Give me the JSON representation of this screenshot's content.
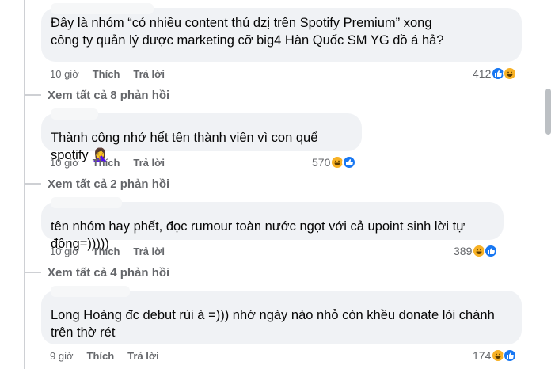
{
  "comments": [
    {
      "text": "Đây là nhóm “có nhiều content thú dzị trên Spotify Premium” xong công ty quản lý được marketing cỡ big4 Hàn Quốc SM YG đồ á hả?",
      "time": "10 giờ",
      "like_label": "Thích",
      "reply_label": "Trả lời",
      "reaction_count": "412",
      "reactions": [
        "like-icon",
        "haha-icon"
      ],
      "view_replies": "Xem tất cả 8 phản hồi"
    },
    {
      "text": "Thành công nhớ hết tên thành viên vì con quể spotify 🤦‍♀️",
      "time": "10 giờ",
      "like_label": "Thích",
      "reply_label": "Trả lời",
      "reaction_count": "570",
      "reactions": [
        "haha-icon",
        "like-icon"
      ],
      "view_replies": "Xem tất cả 2 phản hồi"
    },
    {
      "text": "tên nhóm hay phết, đọc rumour toàn nước ngọt với cả upoint sinh lời tự động=)))))",
      "time": "10 giờ",
      "like_label": "Thích",
      "reply_label": "Trả lời",
      "reaction_count": "389",
      "reactions": [
        "haha-icon",
        "like-icon"
      ],
      "view_replies": "Xem tất cả 4 phản hồi"
    },
    {
      "text": "Long Hoàng đc debut rùi à =))) nhớ ngày nào nhỏ còn khều donate lòi chành trên thờ rét",
      "time": "9 giờ",
      "like_label": "Thích",
      "reply_label": "Trả lời",
      "reaction_count": "174",
      "reactions": [
        "haha-icon",
        "like-icon"
      ]
    }
  ],
  "colors": {
    "bubble": "#f0f2f5",
    "secondary_text": "#65676b",
    "like": "#1877f2",
    "haha": "#f7b125"
  }
}
